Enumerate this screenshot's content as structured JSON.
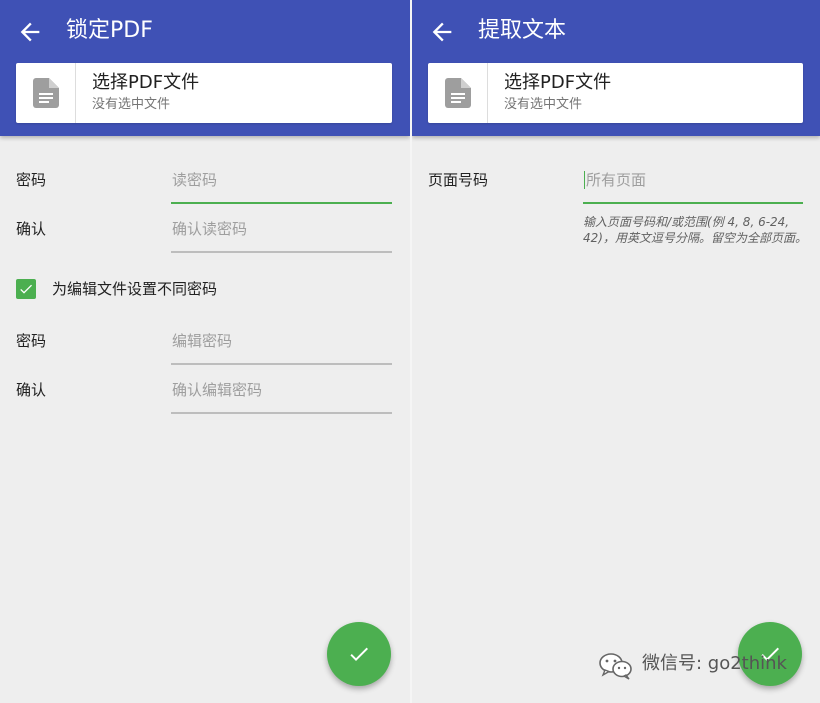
{
  "left": {
    "title": "锁定PDF",
    "back_icon": "arrow-left-icon",
    "file_card": {
      "title": "选择PDF文件",
      "subtitle": "没有选中文件",
      "icon": "file-document-icon"
    },
    "read_password": {
      "label": "密码",
      "placeholder": "读密码",
      "value": ""
    },
    "read_confirm": {
      "label": "确认",
      "placeholder": "确认读密码",
      "value": ""
    },
    "different_edit_password": {
      "label": "为编辑文件设置不同密码",
      "checked": true
    },
    "edit_password": {
      "label": "密码",
      "placeholder": "编辑密码",
      "value": ""
    },
    "edit_confirm": {
      "label": "确认",
      "placeholder": "确认编辑密码",
      "value": ""
    },
    "fab_icon": "check-icon"
  },
  "right": {
    "title": "提取文本",
    "back_icon": "arrow-left-icon",
    "file_card": {
      "title": "选择PDF文件",
      "subtitle": "没有选中文件",
      "icon": "file-document-icon"
    },
    "pages": {
      "label": "页面号码",
      "placeholder": "所有页面",
      "value": ""
    },
    "hint": "输入页面号码和/或范围(例 4, 8, 6-24, 42)，用英文逗号分隔。留空为全部页面。",
    "fab_icon": "check-icon"
  },
  "watermark": {
    "text": "微信号: go2think",
    "icon": "wechat-icon"
  },
  "colors": {
    "primary": "#3f51b5",
    "accent": "#4caf50",
    "background": "#eeeeee"
  }
}
